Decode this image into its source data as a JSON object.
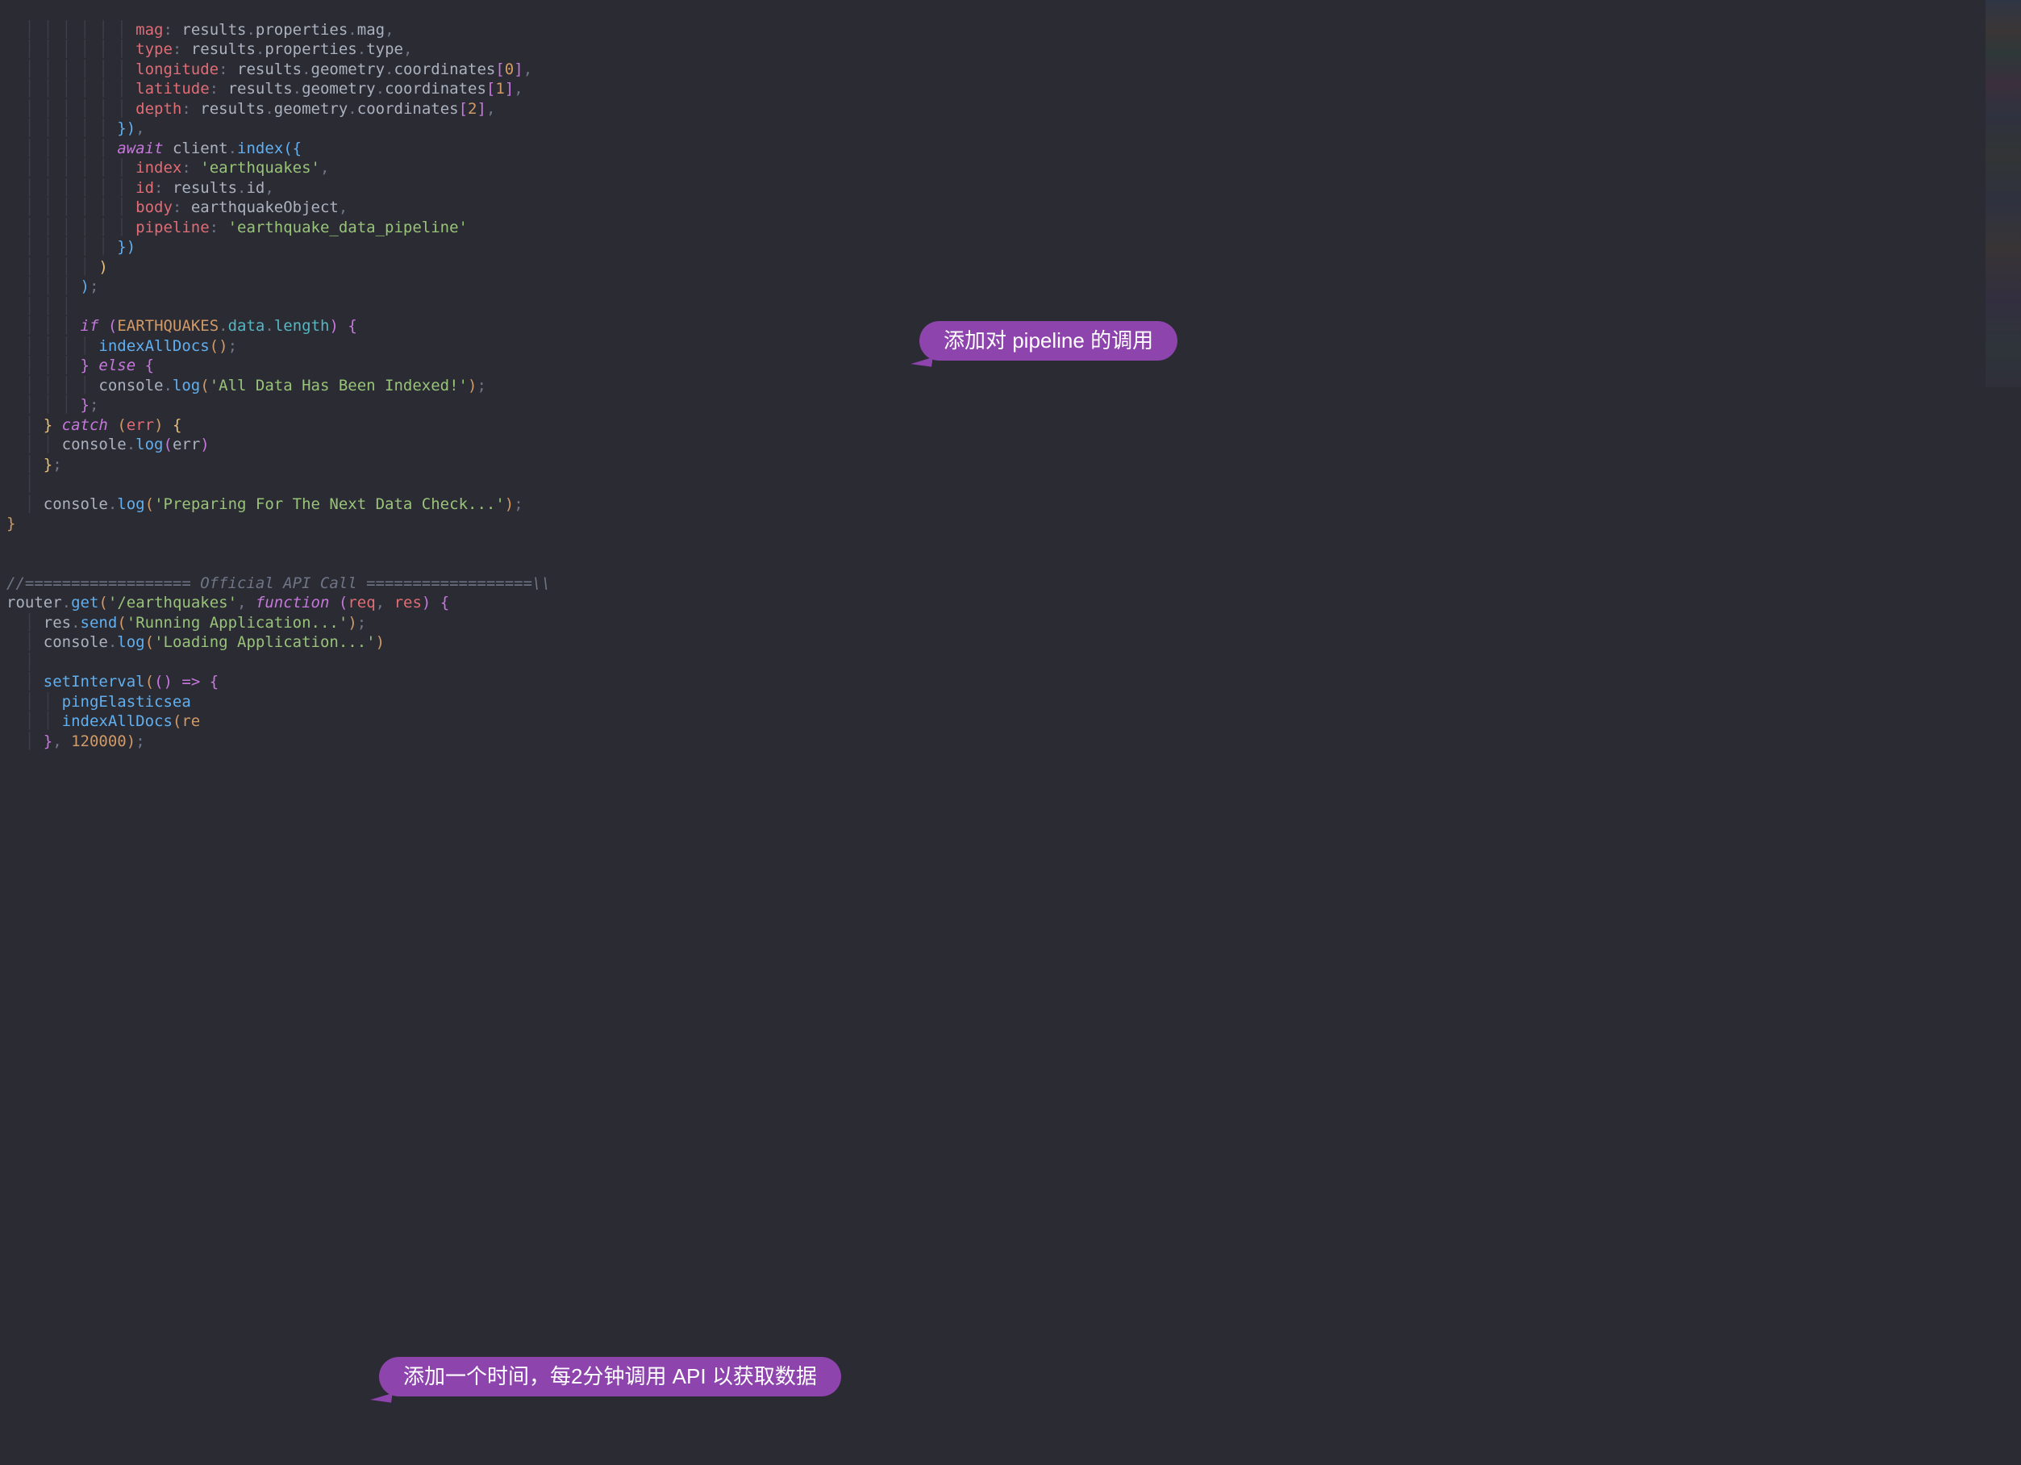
{
  "annotations": {
    "pipeline": "添加对 pipeline 的调用",
    "interval": "添加一个时间，每2分钟调用 API 以获取数据"
  },
  "code": {
    "obj_props": {
      "mag": "mag",
      "type": "type",
      "longitude": "longitude",
      "latitude": "latitude",
      "depth": "depth"
    },
    "rhs": {
      "results": "results",
      "properties": "properties",
      "geometry": "geometry",
      "coordinates": "coordinates",
      "mag": "mag",
      "type": "type",
      "idx0": "0",
      "idx1": "1",
      "idx2": "2"
    },
    "await_kw": "await",
    "client": "client",
    "index_call": "index",
    "index_props": {
      "index": "index",
      "id": "id",
      "body": "body",
      "pipeline": "pipeline"
    },
    "index_vals": {
      "index": "'earthquakes'",
      "results": "results",
      "id_field": "id",
      "body": "earthquakeObject",
      "pipeline": "'earthquake_data_pipeline'"
    },
    "if_kw": "if",
    "else_kw": "else",
    "catch_kw": "catch",
    "EARTHQUAKES": "EARTHQUAKES",
    "data": "data",
    "length": "length",
    "indexAllDocs": "indexAllDocs",
    "console": "console",
    "log": "log",
    "log_all_indexed": "'All Data Has Been Indexed!'",
    "err_param": "err",
    "err_var": "err",
    "log_preparing": "'Preparing For The Next Data Check...'",
    "comment": "//================== Official API Call ==================\\\\",
    "router": "router",
    "get": "get",
    "route_str": "'/earthquakes'",
    "function_kw": "function",
    "req": "req",
    "res": "res",
    "send": "send",
    "send_str": "'Running Application...'",
    "log_loading": "'Loading Application...'",
    "setInterval": "setInterval",
    "pingElasticsearch": "pingElasticsea",
    "indexAllDocs_partial_prefix": "indexAllDocs",
    "indexAllDocs_partial_suffix": "(re",
    "timeout_val": "120000"
  }
}
